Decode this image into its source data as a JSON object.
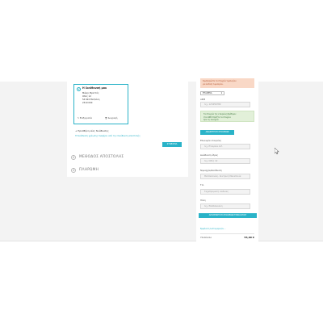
{
  "address_card": {
    "title": "Η διεύθυνσή μου",
    "lines": [
      "Μάκης Βρεττός",
      "Οδός 12",
      "54 624 Θεσ/νίκη",
      "2310 000"
    ],
    "edit": "Επεξεργασία",
    "delete": "Διαγραφή"
  },
  "new_address_label": "+ Προσθήκη νέας διεύθυνσης",
  "billing_link": "Η διεύθυνση χρέωσης διαφέρει από την διεύθυνση αποστολής",
  "next_button": "ΣΥΝΕΧΕΙΑ",
  "sections": [
    {
      "num": "2",
      "label": "ΜΕΘΟΔΟΣ ΑΠΟΣΤΟΛΗΣ"
    },
    {
      "num": "3",
      "label": "ΠΛΗΡΩΜΗ"
    }
  ],
  "right_panel": {
    "notice_lines": [
      "Συμπληρώστε τα στοιχεία τιμολογίου",
      "για έκδοση τιμολογίου."
    ],
    "select_value": "ΕΤΑΙΡΕΙΑ",
    "afm_label": "ΑΦΜ",
    "afm_placeholder": "π.χ. 123456789",
    "success_lines": [
      "Τα στοιχεία της εταιρείας βρέθηκαν",
      "στο ΑΦΜ. Ελέγξτε τα στοιχεία",
      "πριν τη συνέχεια."
    ],
    "search_button": "ΑΝΑΖΗΤΗΣΗ ΣΤΟΙΧΕΙΩΝ",
    "fields": [
      {
        "label": "Επωνυμία εταιρείας",
        "placeholder": "π.χ. Εταιρεία Α.Ε."
      },
      {
        "label": "Διεύθυνση έδρας",
        "placeholder": "π.χ. Οδός 12"
      },
      {
        "label": "Νομαρχία/Διεύθυνση",
        "placeholder": "Θεσσαλονίκη, Κεντρική Μακεδονία"
      },
      {
        "label": "Τ.Κ.",
        "placeholder": "Ταχυδρομικός κώδικας"
      },
      {
        "label": "Πόλη",
        "placeholder": "π.χ. Θεσσαλονίκη"
      }
    ],
    "save_button": "ΑΠΟΘΗΚΕΥΣΗ ΣΤΟΙΧΕΙΩΝ ΤΙΜΟΛΟΓΙΟΥ",
    "show_link": "Εμφάνιση λεπτομερειών",
    "subtotal_label": "Υποσύνολο",
    "subtotal_value": "55,00 €"
  }
}
